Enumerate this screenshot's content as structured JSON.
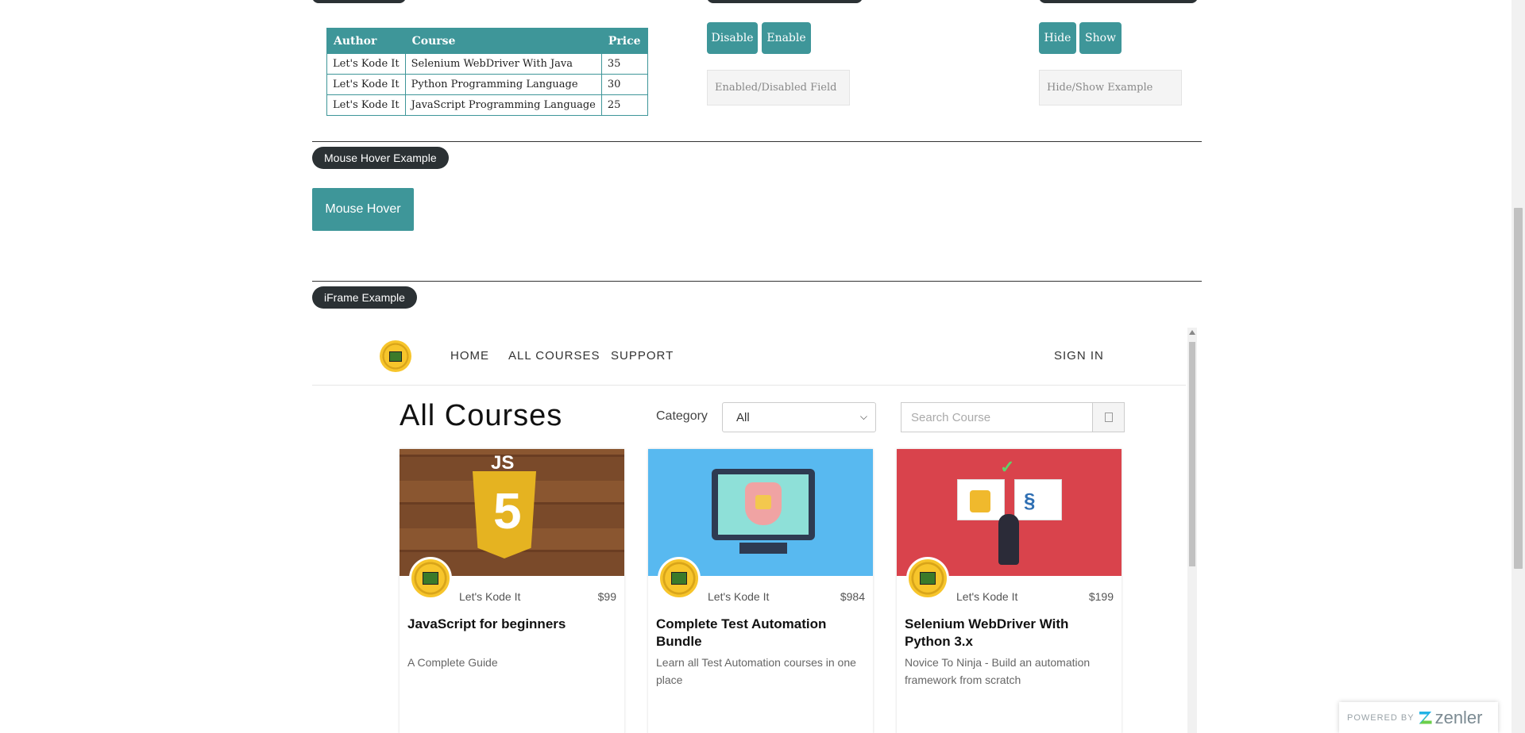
{
  "web_table": {
    "headers": [
      "Author",
      "Course",
      "Price"
    ],
    "rows": [
      [
        "Let's Kode It",
        "Selenium WebDriver With Java",
        "35"
      ],
      [
        "Let's Kode It",
        "Python Programming Language",
        "30"
      ],
      [
        "Let's Kode It",
        "JavaScript Programming Language",
        "25"
      ]
    ]
  },
  "enable_disable": {
    "disable_label": "Disable",
    "enable_label": "Enable",
    "field_placeholder": "Enabled/Disabled Field"
  },
  "hide_show": {
    "hide_label": "Hide",
    "show_label": "Show",
    "field_placeholder": "Hide/Show Example"
  },
  "mouse_hover": {
    "legend": "Mouse Hover Example",
    "button_label": "Mouse Hover"
  },
  "iframe_section": {
    "legend": "iFrame Example"
  },
  "iframe": {
    "nav": {
      "home": "HOME",
      "all_courses": "ALL COURSES",
      "support": "SUPPORT",
      "sign_in": "SIGN IN"
    },
    "heading": "All Courses",
    "category_label": "Category",
    "category_selected": "All",
    "search_placeholder": "Search Course",
    "courses": [
      {
        "author": "Let's Kode It",
        "price": "$99",
        "title": "JavaScript for beginners",
        "description": "A Complete Guide"
      },
      {
        "author": "Let's Kode It",
        "price": "$984",
        "title": "Complete Test Automation Bundle",
        "description": "Learn all Test Automation courses in one place"
      },
      {
        "author": "Let's Kode It",
        "price": "$199",
        "title": "Selenium WebDriver With Python 3.x",
        "description": "Novice To Ninja - Build an automation framework from scratch"
      }
    ]
  },
  "badge": {
    "powered_by": "POWERED BY",
    "brand": "zenler"
  },
  "colors": {
    "teal": "#3e9699",
    "dark_pill": "#2b3134"
  }
}
